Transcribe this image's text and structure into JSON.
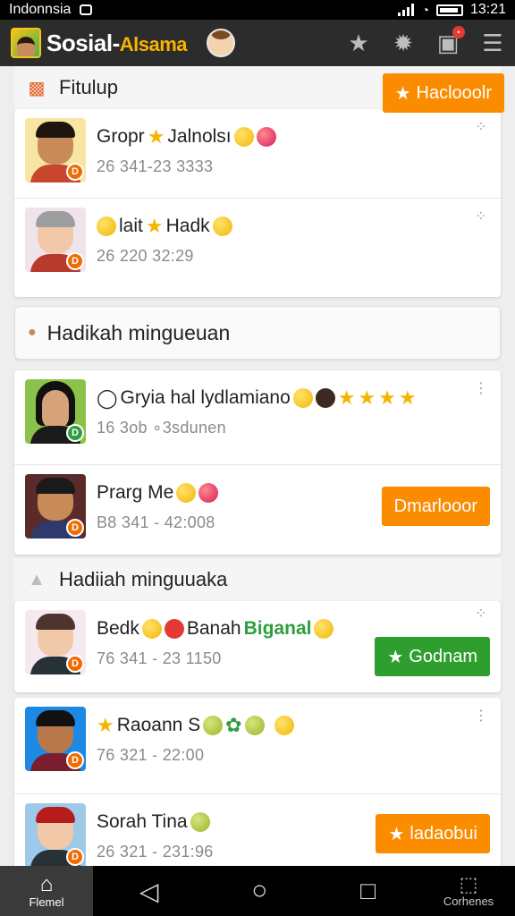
{
  "status_bar": {
    "carrier": "Indonnsia",
    "time": "13:21"
  },
  "app_bar": {
    "title_part1": "Sosial-",
    "title_part2": "Alsama"
  },
  "sections": {
    "s1": {
      "title": "Fitulup"
    },
    "s2": {
      "title": "Hadikah mingueuan",
      "button": "Haclooolr"
    },
    "s3": {
      "title": "Hadiiah minguuaka"
    }
  },
  "rows": [
    {
      "name_a": "Gropr",
      "name_b": "Jalnolsı",
      "meta": "26 341-23 3333"
    },
    {
      "name_a": "lait",
      "name_b": "Hadk",
      "meta": "26 220 32:29"
    },
    {
      "name": "Gryia hal lydlamiano",
      "meta": "16 3ob ∘3sdunen"
    },
    {
      "name": "Prarg Me",
      "meta": "B8 341 - 42:008",
      "button": "Dmarlooor"
    },
    {
      "name_a": "Bedk",
      "name_b": "Banah",
      "name_c": "Biganal",
      "meta": "76 341 - 23 1150",
      "button": "Godnam"
    },
    {
      "name": "Raoann S",
      "meta": "76 321 - 22:00"
    },
    {
      "name": "Sorah Tina",
      "meta": "26 321 - 231:96",
      "button": "ladaobui"
    }
  ],
  "nav": {
    "home_label": "Flemel",
    "right_label": "Corhenes"
  },
  "colors": {
    "accent_orange": "#fb8c00",
    "accent_green": "#2e9e2e",
    "appbar": "#2c2c2c",
    "star": "#f5b400"
  }
}
